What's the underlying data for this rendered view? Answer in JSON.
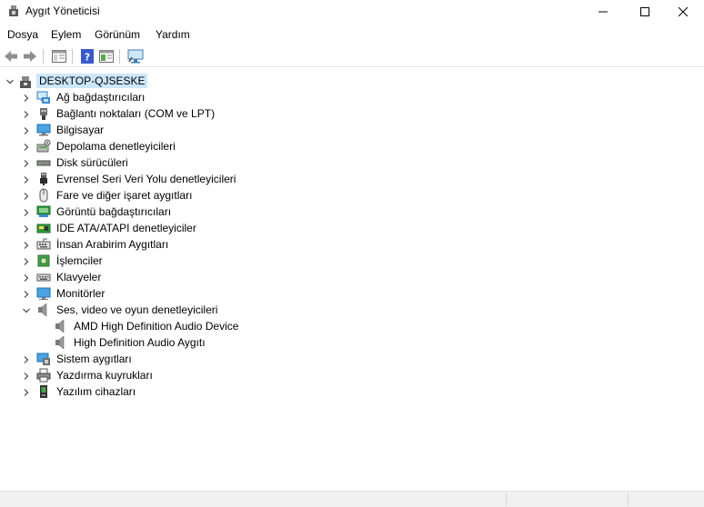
{
  "window": {
    "title": "Aygıt Yöneticisi"
  },
  "menu": {
    "items": [
      "Dosya",
      "Eylem",
      "Görünüm",
      "Yardım"
    ]
  },
  "toolbar": {
    "buttons": [
      "back-arrow-icon",
      "forward-arrow-icon",
      "properties-icon",
      "help-icon",
      "update-driver-icon",
      "scan-hardware-icon"
    ]
  },
  "tree": {
    "root": "DESKTOP-QJSESKE",
    "categories": [
      {
        "label": "Ağ bağdaştırıcıları",
        "icon": "network-adapter-icon",
        "expanded": false
      },
      {
        "label": "Bağlantı noktaları (COM ve LPT)",
        "icon": "port-icon",
        "expanded": false
      },
      {
        "label": "Bilgisayar",
        "icon": "computer-icon",
        "expanded": false
      },
      {
        "label": "Depolama denetleyicileri",
        "icon": "storage-controller-icon",
        "expanded": false
      },
      {
        "label": "Disk sürücüleri",
        "icon": "disk-drive-icon",
        "expanded": false
      },
      {
        "label": "Evrensel Seri Veri Yolu denetleyicileri",
        "icon": "usb-icon",
        "expanded": false
      },
      {
        "label": "Fare ve diğer işaret aygıtları",
        "icon": "mouse-icon",
        "expanded": false
      },
      {
        "label": "Görüntü bağdaştırıcıları",
        "icon": "display-adapter-icon",
        "expanded": false
      },
      {
        "label": "IDE ATA/ATAPI denetleyiciler",
        "icon": "ide-controller-icon",
        "expanded": false
      },
      {
        "label": "İnsan Arabirim Aygıtları",
        "icon": "hid-icon",
        "expanded": false
      },
      {
        "label": "İşlemciler",
        "icon": "processor-icon",
        "expanded": false
      },
      {
        "label": "Klavyeler",
        "icon": "keyboard-icon",
        "expanded": false
      },
      {
        "label": "Monitörler",
        "icon": "monitor-icon",
        "expanded": false
      },
      {
        "label": "Ses, video ve oyun denetleyicileri",
        "icon": "speaker-icon",
        "expanded": true
      },
      {
        "label": "Sistem aygıtları",
        "icon": "system-device-icon",
        "expanded": false
      },
      {
        "label": "Yazdırma kuyrukları",
        "icon": "printer-icon",
        "expanded": false
      },
      {
        "label": "Yazılım cihazları",
        "icon": "software-device-icon",
        "expanded": false
      }
    ],
    "audio_children": [
      {
        "label": "AMD High Definition Audio Device",
        "icon": "speaker-icon"
      },
      {
        "label": "High Definition Audio Aygıtı",
        "icon": "speaker-icon"
      }
    ]
  }
}
